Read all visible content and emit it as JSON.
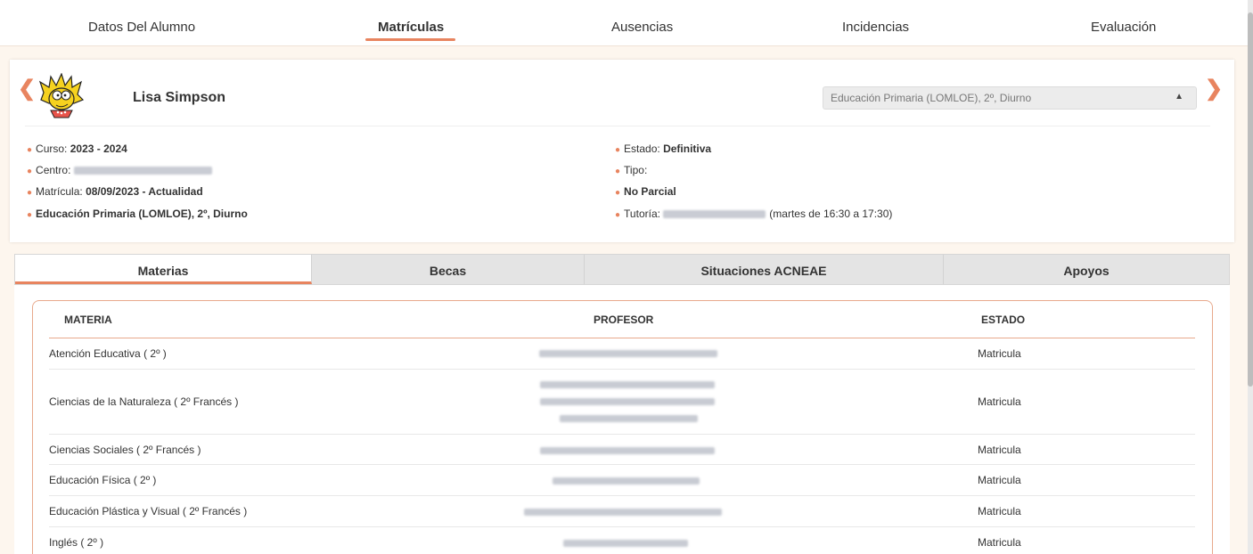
{
  "top_nav": {
    "tabs": [
      {
        "label": "Datos Del Alumno"
      },
      {
        "label": "Matrículas"
      },
      {
        "label": "Ausencias"
      },
      {
        "label": "Incidencias"
      },
      {
        "label": "Evaluación"
      }
    ],
    "active_index": 1
  },
  "student": {
    "name": "Lisa Simpson",
    "enrollment_select": "Educación Primaria (LOMLOE), 2º, Diurno"
  },
  "details": {
    "curso_label": "Curso: ",
    "curso_value": "2023 - 2024",
    "centro_label": "Centro: ",
    "matricula_label": "Matrícula: ",
    "matricula_value": "08/09/2023 - Actualidad",
    "ensenanza": "Educación Primaria (LOMLOE), 2º, Diurno",
    "estado_label": "Estado: ",
    "estado_value": "Definitiva",
    "tipo_label": "Tipo:",
    "parcial": "No Parcial",
    "tutoria_label": "Tutoría: ",
    "tutoria_schedule": "(martes de 16:30 a 17:30)"
  },
  "subtabs": [
    {
      "label": "Materias"
    },
    {
      "label": "Becas"
    },
    {
      "label": "Situaciones ACNEAE"
    },
    {
      "label": "Apoyos"
    }
  ],
  "table": {
    "headers": {
      "materia": "MATERIA",
      "profesor": "PROFESOR",
      "estado": "ESTADO"
    },
    "rows": [
      {
        "materia": "Atención Educativa ( 2º )",
        "estado": "Matricula"
      },
      {
        "materia": "Ciencias de la Naturaleza ( 2º Francés )",
        "estado": "Matricula"
      },
      {
        "materia": "Ciencias Sociales ( 2º Francés )",
        "estado": "Matricula"
      },
      {
        "materia": "Educación Física ( 2º )",
        "estado": "Matricula"
      },
      {
        "materia": "Educación Plástica y Visual ( 2º Francés )",
        "estado": "Matricula"
      },
      {
        "materia": "Inglés ( 2º )",
        "estado": "Matricula"
      }
    ]
  },
  "colors": {
    "accent": "#e8845f",
    "background": "#fdf6ee",
    "tab_inactive": "#e4e4e4"
  },
  "icons": {
    "prev": "chevron-left-icon",
    "next": "chevron-right-icon",
    "select_caret": "sort-caret-icon",
    "bullet": "dot-icon"
  }
}
